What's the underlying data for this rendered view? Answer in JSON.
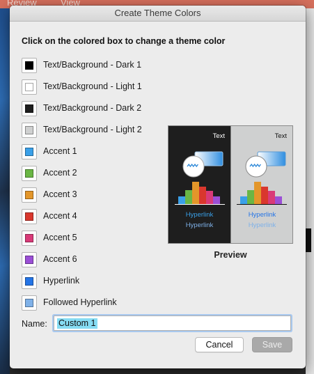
{
  "background": {
    "menu_items": [
      "Review",
      "View"
    ]
  },
  "dialog": {
    "title": "Create Theme Colors",
    "instruction": "Click on the colored box to change a theme color",
    "colors": [
      {
        "label": "Text/Background - Dark 1",
        "color": "#000000"
      },
      {
        "label": "Text/Background - Light 1",
        "color": "#ffffff"
      },
      {
        "label": "Text/Background - Dark 2",
        "color": "#1e1e1e"
      },
      {
        "label": "Text/Background - Light 2",
        "color": "#cfd0d0"
      },
      {
        "label": "Accent 1",
        "color": "#3aa0e8"
      },
      {
        "label": "Accent 2",
        "color": "#6ab644"
      },
      {
        "label": "Accent 3",
        "color": "#e3962a"
      },
      {
        "label": "Accent 4",
        "color": "#d9372d"
      },
      {
        "label": "Accent 5",
        "color": "#d93a78"
      },
      {
        "label": "Accent 6",
        "color": "#9b4fd6"
      },
      {
        "label": "Hyperlink",
        "color": "#2474e6"
      },
      {
        "label": "Followed Hyperlink",
        "color": "#7fb1e8"
      }
    ],
    "preview": {
      "dark_text": "Text",
      "light_text": "Text",
      "hyperlink": "Hyperlink",
      "followed_hyperlink": "Hyperlink",
      "label": "Preview"
    },
    "name": {
      "label": "Name:",
      "value": "Custom 1"
    },
    "buttons": {
      "cancel": "Cancel",
      "save": "Save"
    }
  }
}
